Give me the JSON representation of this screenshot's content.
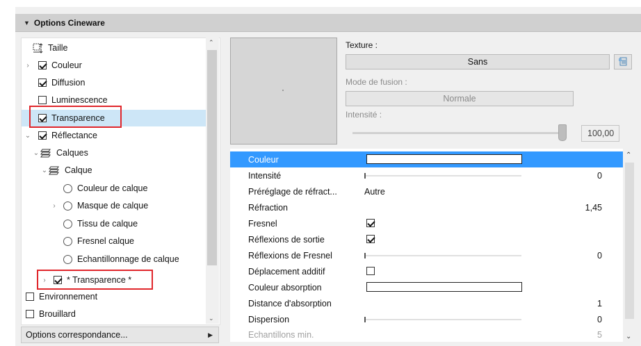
{
  "header": {
    "title": "Options Cineware"
  },
  "tree": {
    "items": [
      {
        "label": "Taille",
        "kind": "icon",
        "icon": "size-icon",
        "checked": false,
        "expander": ""
      },
      {
        "label": "Couleur",
        "kind": "checkbox",
        "checked": true,
        "expander": ">"
      },
      {
        "label": "Diffusion",
        "kind": "checkbox",
        "checked": true,
        "expander": ""
      },
      {
        "label": "Luminescence",
        "kind": "checkbox",
        "checked": false,
        "expander": ""
      },
      {
        "label": "Transparence",
        "kind": "checkbox",
        "checked": true,
        "expander": "",
        "selected": true,
        "highlighted": true
      },
      {
        "label": "Réflectance",
        "kind": "checkbox",
        "checked": true,
        "expander": "v"
      },
      {
        "label": "Calques",
        "kind": "icon",
        "icon": "layers-icon",
        "expander": "v"
      },
      {
        "label": "Calque",
        "kind": "icon",
        "icon": "layer-icon",
        "expander": "v"
      },
      {
        "label": "Couleur de calque",
        "kind": "radio",
        "expander": ""
      },
      {
        "label": "Masque de calque",
        "kind": "radio",
        "expander": ">"
      },
      {
        "label": "Tissu de calque",
        "kind": "radio",
        "expander": ""
      },
      {
        "label": "Fresnel calque",
        "kind": "radio",
        "expander": ""
      },
      {
        "label": "Echantillonnage de calque",
        "kind": "radio",
        "expander": ""
      },
      {
        "label": "* Transparence *",
        "kind": "checkbox",
        "checked": true,
        "expander": ">",
        "highlighted": true
      },
      {
        "label": "Environnement",
        "kind": "checkbox",
        "checked": false,
        "expander": ""
      },
      {
        "label": "Brouillard",
        "kind": "checkbox",
        "checked": false,
        "expander": ""
      }
    ]
  },
  "footer": {
    "label": "Options correspondance..."
  },
  "texture": {
    "label": "Texture :",
    "value": "Sans",
    "blend_label": "Mode de fusion :",
    "blend_value": "Normale",
    "intensity_label": "Intensité :",
    "intensity_value": "100,00",
    "intensity_level": 1.0
  },
  "properties": [
    {
      "name": "Couleur",
      "type": "color",
      "selected": true
    },
    {
      "name": "Intensité",
      "type": "slider",
      "value": "0"
    },
    {
      "name": "Préréglage de réfract...",
      "type": "text",
      "text": "Autre"
    },
    {
      "name": "Réfraction",
      "type": "value",
      "value": "1,45"
    },
    {
      "name": "Fresnel",
      "type": "checkbox",
      "checked": true
    },
    {
      "name": "Réflexions de sortie",
      "type": "checkbox",
      "checked": true
    },
    {
      "name": "Réflexions de Fresnel",
      "type": "slider",
      "value": "0"
    },
    {
      "name": "Déplacement additif",
      "type": "checkbox",
      "checked": false
    },
    {
      "name": "Couleur absorption",
      "type": "color"
    },
    {
      "name": "Distance d'absorption",
      "type": "value",
      "value": "1"
    },
    {
      "name": "Dispersion",
      "type": "slider",
      "value": "0"
    },
    {
      "name": "Echantillons min.",
      "type": "value",
      "value": "5",
      "disabled": true
    }
  ],
  "colors": {
    "accent": "#3399ff",
    "selection": "#cde6f7",
    "highlight_border": "#e0262b"
  }
}
